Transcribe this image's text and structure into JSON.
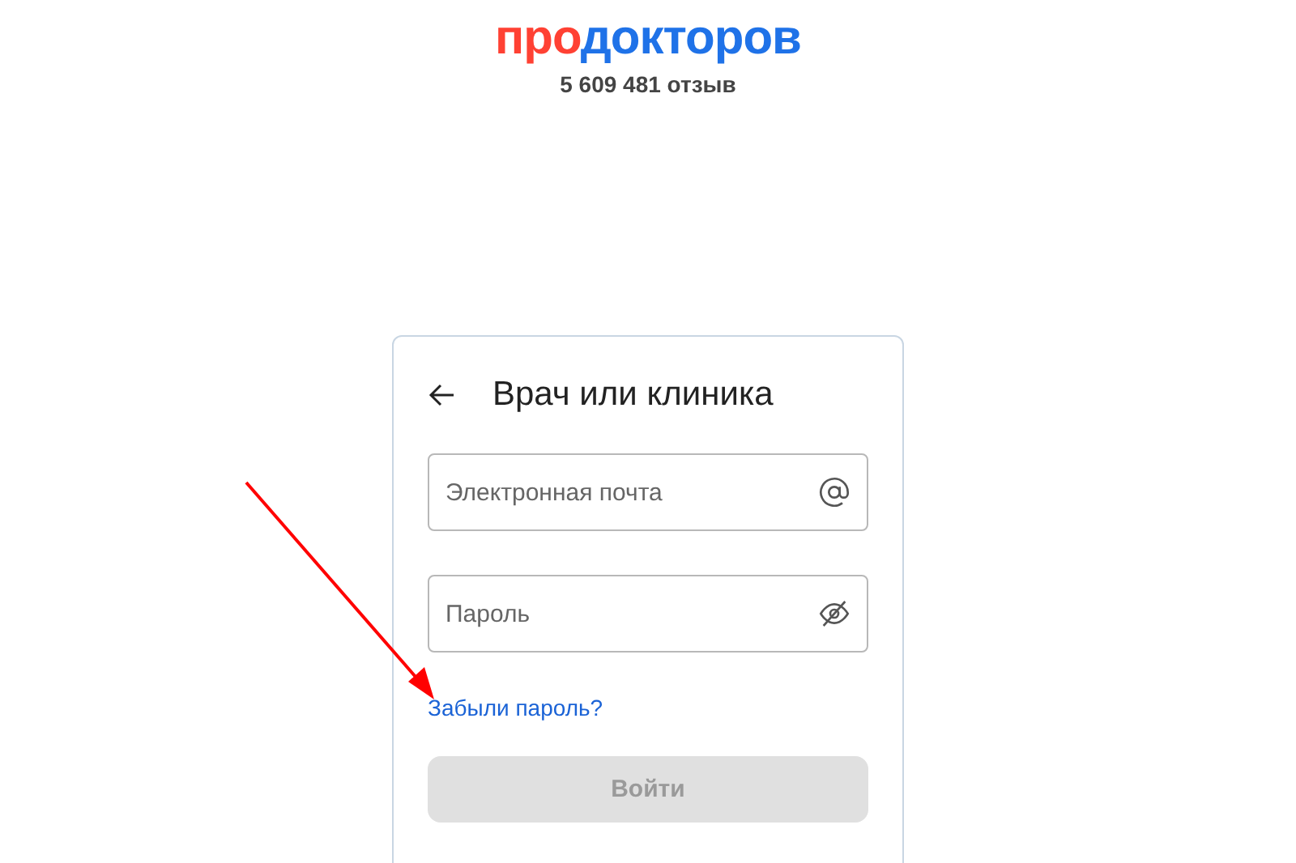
{
  "logo": {
    "prefix": "про",
    "name": "докторов"
  },
  "reviews": "5 609 481 отзыв",
  "login_card": {
    "title": "Врач или клиника",
    "fields": [
      {
        "kind": "email",
        "placeholder": "Электронная почта"
      },
      {
        "kind": "password",
        "placeholder": "Пароль"
      }
    ],
    "forgot_link": "Забыли пароль?",
    "submit": {
      "label": "Войти",
      "disabled": true
    }
  },
  "annotation": {
    "kind": "arrow",
    "color": "#ff0000"
  }
}
